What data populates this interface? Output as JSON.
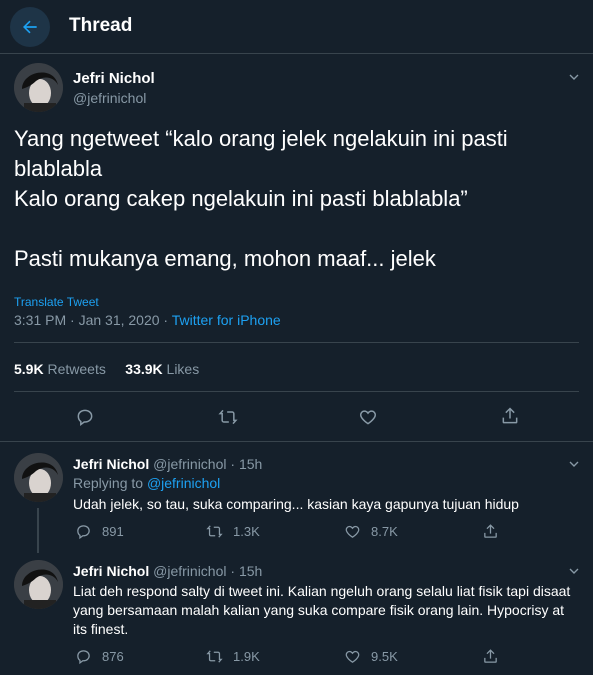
{
  "header": {
    "title": "Thread"
  },
  "main_tweet": {
    "name": "Jefri Nichol",
    "handle": "@jefrinichol",
    "text": "Yang ngetweet “kalo orang jelek ngelakuin ini pasti blablabla\nKalo orang cakep ngelakuin ini pasti blablabla”\n\nPasti mukanya emang, mohon maaf... jelek",
    "translate_label": "Translate Tweet",
    "timestamp": "3:31 PM · Jan 31, 2020 · ",
    "source": "Twitter for iPhone",
    "retweets_count": "5.9K",
    "retweets_label": "Retweets",
    "likes_count": "33.9K",
    "likes_label": "Likes"
  },
  "replies": [
    {
      "name": "Jefri Nichol",
      "handle": "@jefrinichol",
      "time": "· 15h",
      "replying_prefix": "Replying to ",
      "replying_to": "@jefrinichol",
      "text": "Udah jelek, so tau, suka comparing... kasian kaya gapunya tujuan hidup",
      "reply_count": "891",
      "retweet_count": "1.3K",
      "like_count": "8.7K"
    },
    {
      "name": "Jefri Nichol",
      "handle": "@jefrinichol",
      "time": "· 15h",
      "text": "Liat deh respond salty di tweet ini. Kalian ngeluh orang selalu liat fisik tapi disaat yang bersamaan malah kalian yang suka compare fisik orang lain. Hypocrisy at its finest.",
      "reply_count": "876",
      "retweet_count": "1.9K",
      "like_count": "9.5K"
    }
  ],
  "colors": {
    "background": "#15202b",
    "accent": "#1da1f2",
    "muted": "#8899a6",
    "divider": "#38444d"
  },
  "icons": [
    "back-arrow-icon",
    "chevron-down-icon",
    "reply-icon",
    "retweet-icon",
    "like-icon",
    "share-icon"
  ]
}
